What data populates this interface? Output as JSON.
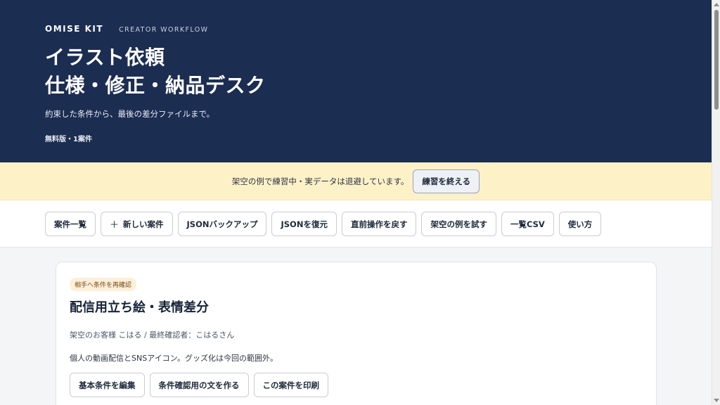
{
  "header": {
    "brand": "OMISE KIT",
    "brand_sub": "CREATOR WORKFLOW",
    "title_line1": "イラスト依頼",
    "title_line2": "仕様・修正・納品デスク",
    "description": "約束した条件から、最後の差分ファイルまで。",
    "plan": "無料版・1案件"
  },
  "banner": {
    "text": "架空の例で練習中・実データは退避しています。",
    "end_button": "練習を終える"
  },
  "toolbar": {
    "buttons": [
      {
        "label": "案件一覧"
      },
      {
        "label": "新しい案件",
        "icon": "plus-icon",
        "icon_glyph": "＋"
      },
      {
        "label": "JSONバックアップ"
      },
      {
        "label": "JSONを復元"
      },
      {
        "label": "直前操作を戻す"
      },
      {
        "label": "架空の例を試す"
      },
      {
        "label": "一覧CSV"
      },
      {
        "label": "使い方"
      }
    ]
  },
  "card": {
    "badge": "相手へ条件を再確認",
    "title": "配信用立ち絵・表情差分",
    "meta": "架空のお客様 こはる / 最終確認者：こはるさん",
    "note": "個人の動画配信とSNSアイコン。グッズ化は今回の範囲外。",
    "actions": [
      {
        "label": "基本条件を編集"
      },
      {
        "label": "条件確認用の文を作る"
      },
      {
        "label": "この案件を印刷"
      }
    ]
  },
  "colors": {
    "hero_bg": "#1c2d52",
    "banner_bg": "#fdf1c8",
    "badge_bg": "#fdefd9"
  }
}
